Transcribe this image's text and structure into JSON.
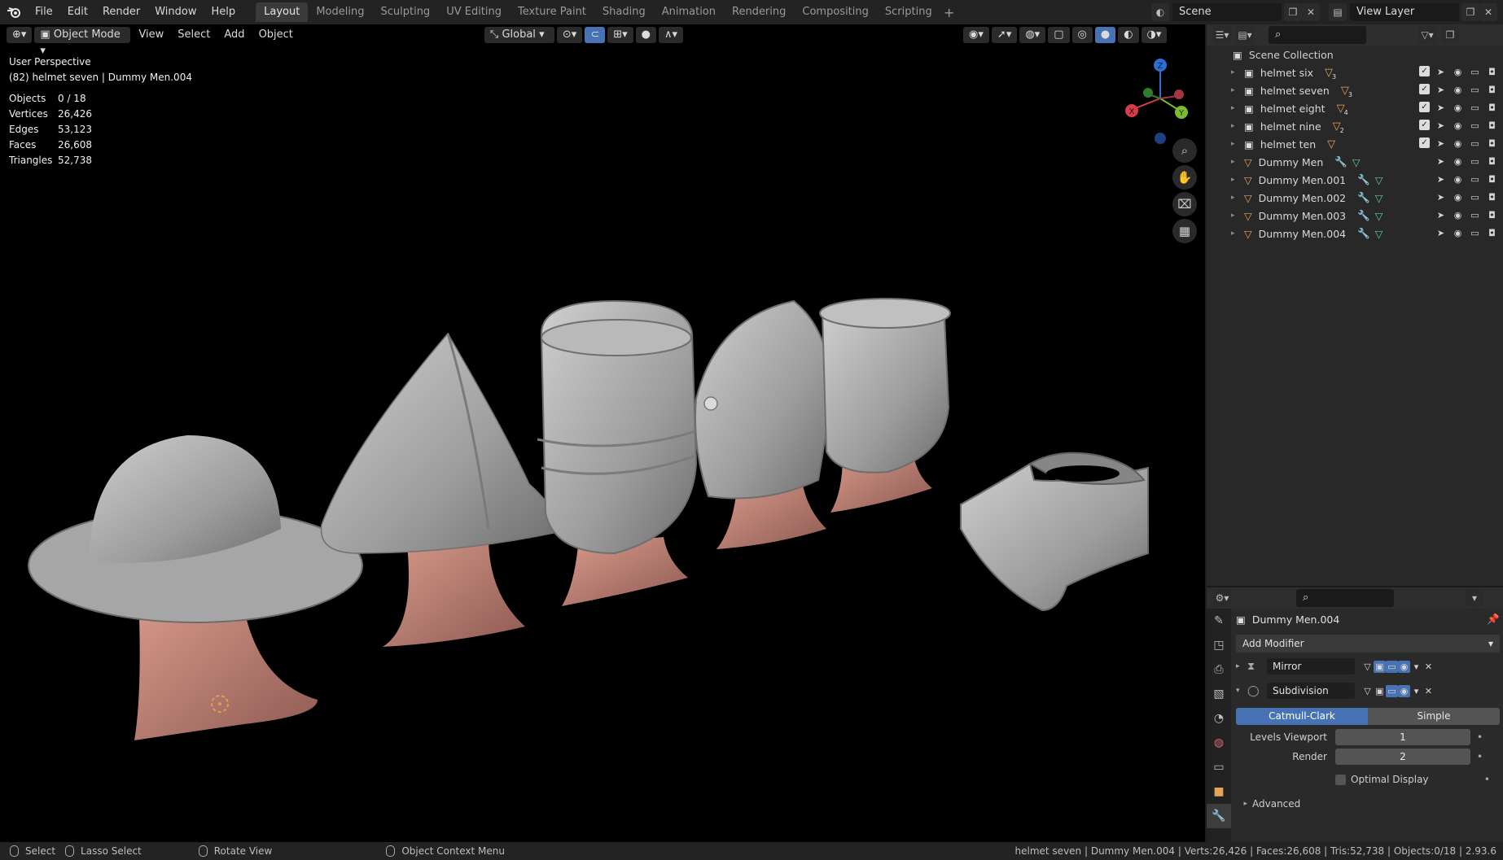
{
  "topbar": {
    "menus": [
      "File",
      "Edit",
      "Render",
      "Window",
      "Help"
    ],
    "workspaces": [
      "Layout",
      "Modeling",
      "Sculpting",
      "UV Editing",
      "Texture Paint",
      "Shading",
      "Animation",
      "Rendering",
      "Compositing",
      "Scripting"
    ],
    "active_workspace": "Layout",
    "scene": "Scene",
    "view_layer": "View Layer"
  },
  "viewport": {
    "mode": "Object Mode",
    "menus": [
      "View",
      "Select",
      "Add",
      "Object"
    ],
    "orientation": "Global",
    "title": "User Perspective",
    "subtitle": "(82) helmet seven | Dummy Men.004",
    "stats": [
      {
        "k": "Objects",
        "v": "0 / 18"
      },
      {
        "k": "Vertices",
        "v": "26,426"
      },
      {
        "k": "Edges",
        "v": "53,123"
      },
      {
        "k": "Faces",
        "v": "26,608"
      },
      {
        "k": "Triangles",
        "v": "52,738"
      }
    ],
    "gizmo": {
      "x": "X",
      "y": "Y",
      "z": "Z"
    }
  },
  "outliner": {
    "root": "Scene Collection",
    "items": [
      {
        "label": "helmet six",
        "type": "collection",
        "badge": "3"
      },
      {
        "label": "helmet seven",
        "type": "collection",
        "badge": "3"
      },
      {
        "label": "helmet eight",
        "type": "collection",
        "badge": "4"
      },
      {
        "label": "helmet nine",
        "type": "collection",
        "badge": "2"
      },
      {
        "label": "helmet ten",
        "type": "collection",
        "badge": ""
      },
      {
        "label": "Dummy Men",
        "type": "mesh",
        "badge": ""
      },
      {
        "label": "Dummy Men.001",
        "type": "mesh",
        "badge": ""
      },
      {
        "label": "Dummy Men.002",
        "type": "mesh",
        "badge": ""
      },
      {
        "label": "Dummy Men.003",
        "type": "mesh",
        "badge": ""
      },
      {
        "label": "Dummy Men.004",
        "type": "mesh",
        "badge": ""
      }
    ]
  },
  "properties": {
    "object_name": "Dummy Men.004",
    "add_modifier": "Add Modifier",
    "modifiers": [
      {
        "name": "Mirror",
        "expanded": false
      },
      {
        "name": "Subdivision",
        "expanded": true
      }
    ],
    "subdivision": {
      "mode_active": "Catmull-Clark",
      "mode_other": "Simple",
      "levels_viewport_label": "Levels Viewport",
      "levels_viewport": "1",
      "render_label": "Render",
      "render": "2",
      "optimal_display": "Optimal Display",
      "advanced": "Advanced"
    }
  },
  "statusbar": {
    "select": "Select",
    "lasso": "Lasso Select",
    "rotate": "Rotate View",
    "context": "Object Context Menu",
    "info": "helmet seven | Dummy Men.004 | Verts:26,426 | Faces:26,608 | Tris:52,738 | Objects:0/18 | 2.93.6"
  },
  "colors": {
    "accent": "#4772b3",
    "mesh_orange": "#e8a35a",
    "skin": "#c88a7e",
    "metal": "#a3a3a3"
  }
}
